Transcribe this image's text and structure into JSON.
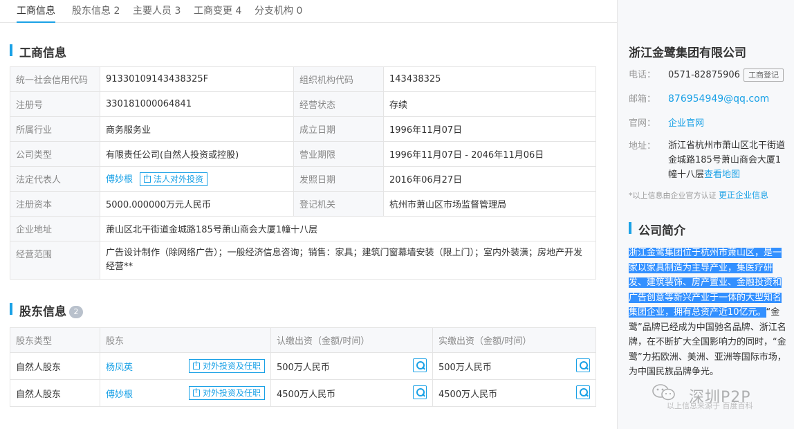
{
  "tabs": [
    {
      "label": "工商信息"
    },
    {
      "label": "股东信息 2"
    },
    {
      "label": "主要人员 3"
    },
    {
      "label": "工商变更 4"
    },
    {
      "label": "分支机构 0"
    }
  ],
  "business": {
    "title": "工商信息",
    "rows": [
      {
        "l1": "统一社会信用代码",
        "v1": "91330109143438325F",
        "l2": "组织机构代码",
        "v2": "143438325"
      },
      {
        "l1": "注册号",
        "v1": "330181000064841",
        "l2": "经营状态",
        "v2": "存续"
      },
      {
        "l1": "所属行业",
        "v1": "商务服务业",
        "l2": "成立日期",
        "v2": "1996年11月07日"
      },
      {
        "l1": "公司类型",
        "v1": "有限责任公司(自然人投资或控股)",
        "l2": "营业期限",
        "v2": "1996年11月07日 - 2046年11月06日"
      },
      {
        "l1": "法定代表人",
        "v1": "傅妙根",
        "v1_btn": "法人对外投资",
        "l2": "发照日期",
        "v2": "2016年06月27日"
      },
      {
        "l1": "注册资本",
        "v1": "5000.000000万元人民币",
        "l2": "登记机关",
        "v2": "杭州市萧山区市场监督管理局"
      }
    ],
    "address_label": "企业地址",
    "address": "萧山区北干街道金城路185号萧山商会大厦1幢十八层",
    "scope_label": "经营范围",
    "scope": "广告设计制作（除网络广告）；一般经济信息咨询；销售：家具；建筑门窗幕墙安装（限上门）；室内外装潢；房地产开发经营**"
  },
  "shareholders": {
    "title": "股东信息",
    "count": "2",
    "headers": [
      "股东类型",
      "股东",
      "认缴出资（金额/时间）",
      "实缴出资（金额/时间）"
    ],
    "rows": [
      {
        "type": "自然人股东",
        "name": "杨凤英",
        "btn": "对外投资及任职",
        "subscribed": "500万人民币",
        "paid": "500万人民币"
      },
      {
        "type": "自然人股东",
        "name": "傅妙根",
        "btn": "对外投资及任职",
        "subscribed": "4500万人民币",
        "paid": "4500万人民币"
      }
    ]
  },
  "sidebar": {
    "company": "浙江金鹭集团有限公司",
    "phone_label": "电话：",
    "phone": "0571-82875906",
    "phone_btn": "工商登记",
    "email_label": "邮箱：",
    "email": "876954949@qq.com",
    "site_label": "官网：",
    "site": "企业官网",
    "addr_label": "地址：",
    "addr": "浙江省杭州市萧山区北干街道金城路185号萧山商会大厦1幢十八层",
    "map_link": "查看地图",
    "note": "*以上信息由企业官方认证",
    "correct_link": "更正企业信息",
    "intro_title": "公司简介",
    "intro_highlight": "浙江金鹭集团位于杭州市萧山区，是一家以家具制造为主导产业，集医疗研发、建筑装饰、房产置业、金融投资和广告创意等新兴产业于一体的大型知名集团企业，拥有总资产近10亿元。",
    "intro_rest": "“金鹭”品牌已经成为中国驰名品牌、浙江名牌，在不断扩大全国影响力的同时，“金鹭”力拓欧洲、美洲、亚洲等国际市场，为中国民族品牌争光。",
    "watermark": "深圳P2P",
    "watermark_src": "以上信息来源于 百度百科"
  },
  "colors": {
    "accent": "#1aa1e6",
    "highlight": "#3390ff"
  }
}
